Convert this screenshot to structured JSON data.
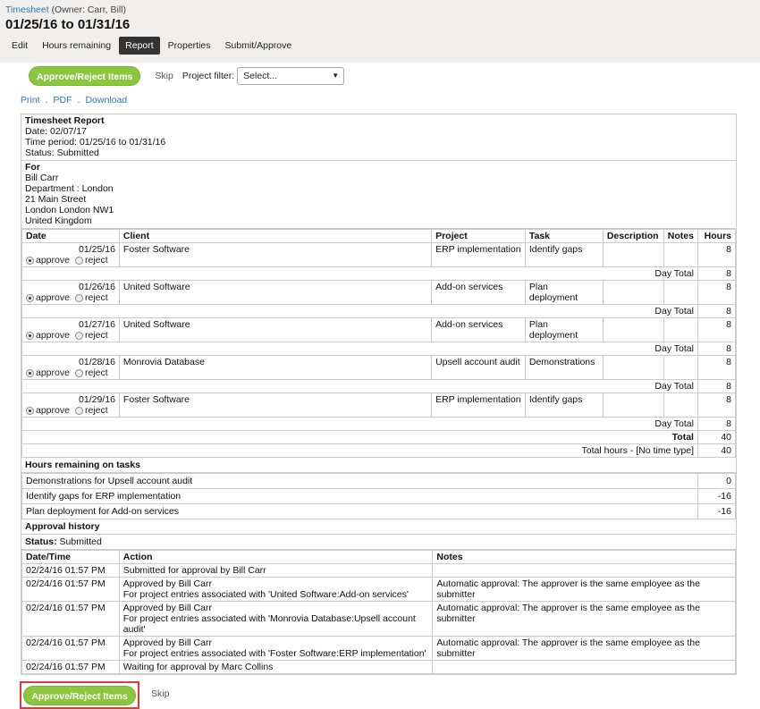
{
  "header": {
    "crumb_link": "Timesheet",
    "owner": "(Owner: Carr, Bill)",
    "period": "01/25/16 to 01/31/16",
    "tabs": [
      "Edit",
      "Hours remaining",
      "Report",
      "Properties",
      "Submit/Approve"
    ],
    "active_tab": "Report"
  },
  "actions": {
    "approve_label": "Approve/Reject Items",
    "skip_label": "Skip",
    "project_filter_label": "Project filter:",
    "project_filter_value": "Select..."
  },
  "links": [
    "Print",
    "PDF",
    "Download"
  ],
  "report": {
    "title": "Timesheet Report",
    "date": "Date: 02/07/17",
    "period": "Time period: 01/25/16 to 01/31/16",
    "status": "Status: Submitted",
    "for_label": "For",
    "for_lines": [
      "Bill Carr",
      "Department : London",
      "21 Main Street",
      "London London NW1",
      "United Kingdom"
    ],
    "columns": [
      "Date",
      "Client",
      "Project",
      "Task",
      "Description",
      "Notes",
      "Hours"
    ],
    "approve_radio": "approve",
    "reject_radio": "reject",
    "day_total_label": "Day Total",
    "entries": [
      {
        "date": "01/25/16",
        "client": "Foster Software",
        "project": "ERP implementation",
        "task": "Identify gaps",
        "description": "",
        "notes": "",
        "hours": "8",
        "day_total": "8"
      },
      {
        "date": "01/26/16",
        "client": "United Software",
        "project": "Add-on services",
        "task": "Plan deployment",
        "description": "",
        "notes": "",
        "hours": "8",
        "day_total": "8"
      },
      {
        "date": "01/27/16",
        "client": "United Software",
        "project": "Add-on services",
        "task": "Plan deployment",
        "description": "",
        "notes": "",
        "hours": "8",
        "day_total": "8"
      },
      {
        "date": "01/28/16",
        "client": "Monrovia Database",
        "project": "Upsell account audit",
        "task": "Demonstrations",
        "description": "",
        "notes": "",
        "hours": "8",
        "day_total": "8"
      },
      {
        "date": "01/29/16",
        "client": "Foster Software",
        "project": "ERP implementation",
        "task": "Identify gaps",
        "description": "",
        "notes": "",
        "hours": "8",
        "day_total": "8"
      }
    ],
    "total_label": "Total",
    "total_value": "40",
    "total_hours_label": "Total hours - [No time type]",
    "total_hours_value": "40",
    "hours_remaining_title": "Hours remaining on tasks",
    "hours_remaining": [
      {
        "task": "Demonstrations for Upsell account audit",
        "value": "0"
      },
      {
        "task": "Identify gaps for ERP implementation",
        "value": "-16"
      },
      {
        "task": "Plan deployment for Add-on services",
        "value": "-16"
      }
    ],
    "approval_history_title": "Approval history",
    "approval_status_label": "Status:",
    "approval_status_value": "Submitted",
    "history_columns": [
      "Date/Time",
      "Action",
      "Notes"
    ],
    "history": [
      {
        "datetime": "02/24/16 01:57 PM",
        "action": "Submitted for approval by Bill Carr",
        "action2": "",
        "notes": ""
      },
      {
        "datetime": "02/24/16 01:57 PM",
        "action": "Approved by Bill Carr",
        "action2": "For project entries associated with 'United Software:Add-on services'",
        "notes": "Automatic approval: The approver is the same employee as the submitter"
      },
      {
        "datetime": "02/24/16 01:57 PM",
        "action": "Approved by Bill Carr",
        "action2": "For project entries associated with 'Monrovia Database:Upsell account audit'",
        "notes": "Automatic approval: The approver is the same employee as the submitter"
      },
      {
        "datetime": "02/24/16 01:57 PM",
        "action": "Approved by Bill Carr",
        "action2": "For project entries associated with 'Foster Software:ERP implementation'",
        "notes": "Automatic approval: The approver is the same employee as the submitter"
      },
      {
        "datetime": "02/24/16 01:57 PM",
        "action": "Waiting for approval by Marc Collins",
        "action2": "",
        "notes": ""
      }
    ]
  },
  "colors": {
    "accent_green": "#8cc63f",
    "link_blue": "#2a7ab8",
    "highlight_red": "#e03b3b"
  }
}
